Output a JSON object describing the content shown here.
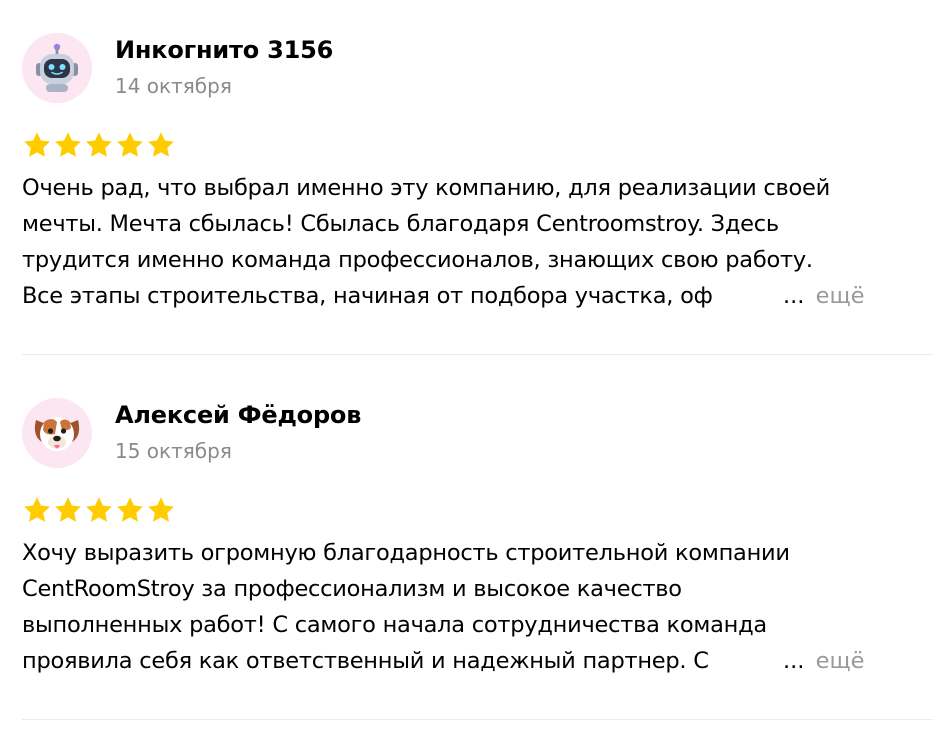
{
  "colors": {
    "star": "#ffcc00",
    "date": "#8a8a8a",
    "more_link": "#9a9a9a",
    "avatar_bg": "#fbe6f1"
  },
  "reviews": [
    {
      "author": "Инкогнито 3156",
      "date": "14 октября",
      "rating": 5,
      "avatar_icon": "robot-icon",
      "lines": [
        "Очень рад, что выбрал именно эту компанию, для реализации своей",
        "мечты. Мечта сбылась! Сбылась благодаря Centroomstroy. Здесь",
        "трудится именно команда профессионалов, знающих свою работу.",
        "Все этапы строительства, начиная от подбора участка, оф"
      ],
      "ellipsis": "...",
      "more_label": "ещё"
    },
    {
      "author": "Алексей Фёдоров",
      "date": "15 октября",
      "rating": 5,
      "avatar_icon": "dog-icon",
      "lines": [
        "Хочу выразить огромную благодарность строительной компании",
        "CentRoomStroy за профессионализм и высокое качество",
        "выполненных работ! С самого начала сотрудничества команда",
        "проявила себя как ответственный и надежный партнер. С"
      ],
      "ellipsis": "...",
      "more_label": "ещё"
    }
  ]
}
